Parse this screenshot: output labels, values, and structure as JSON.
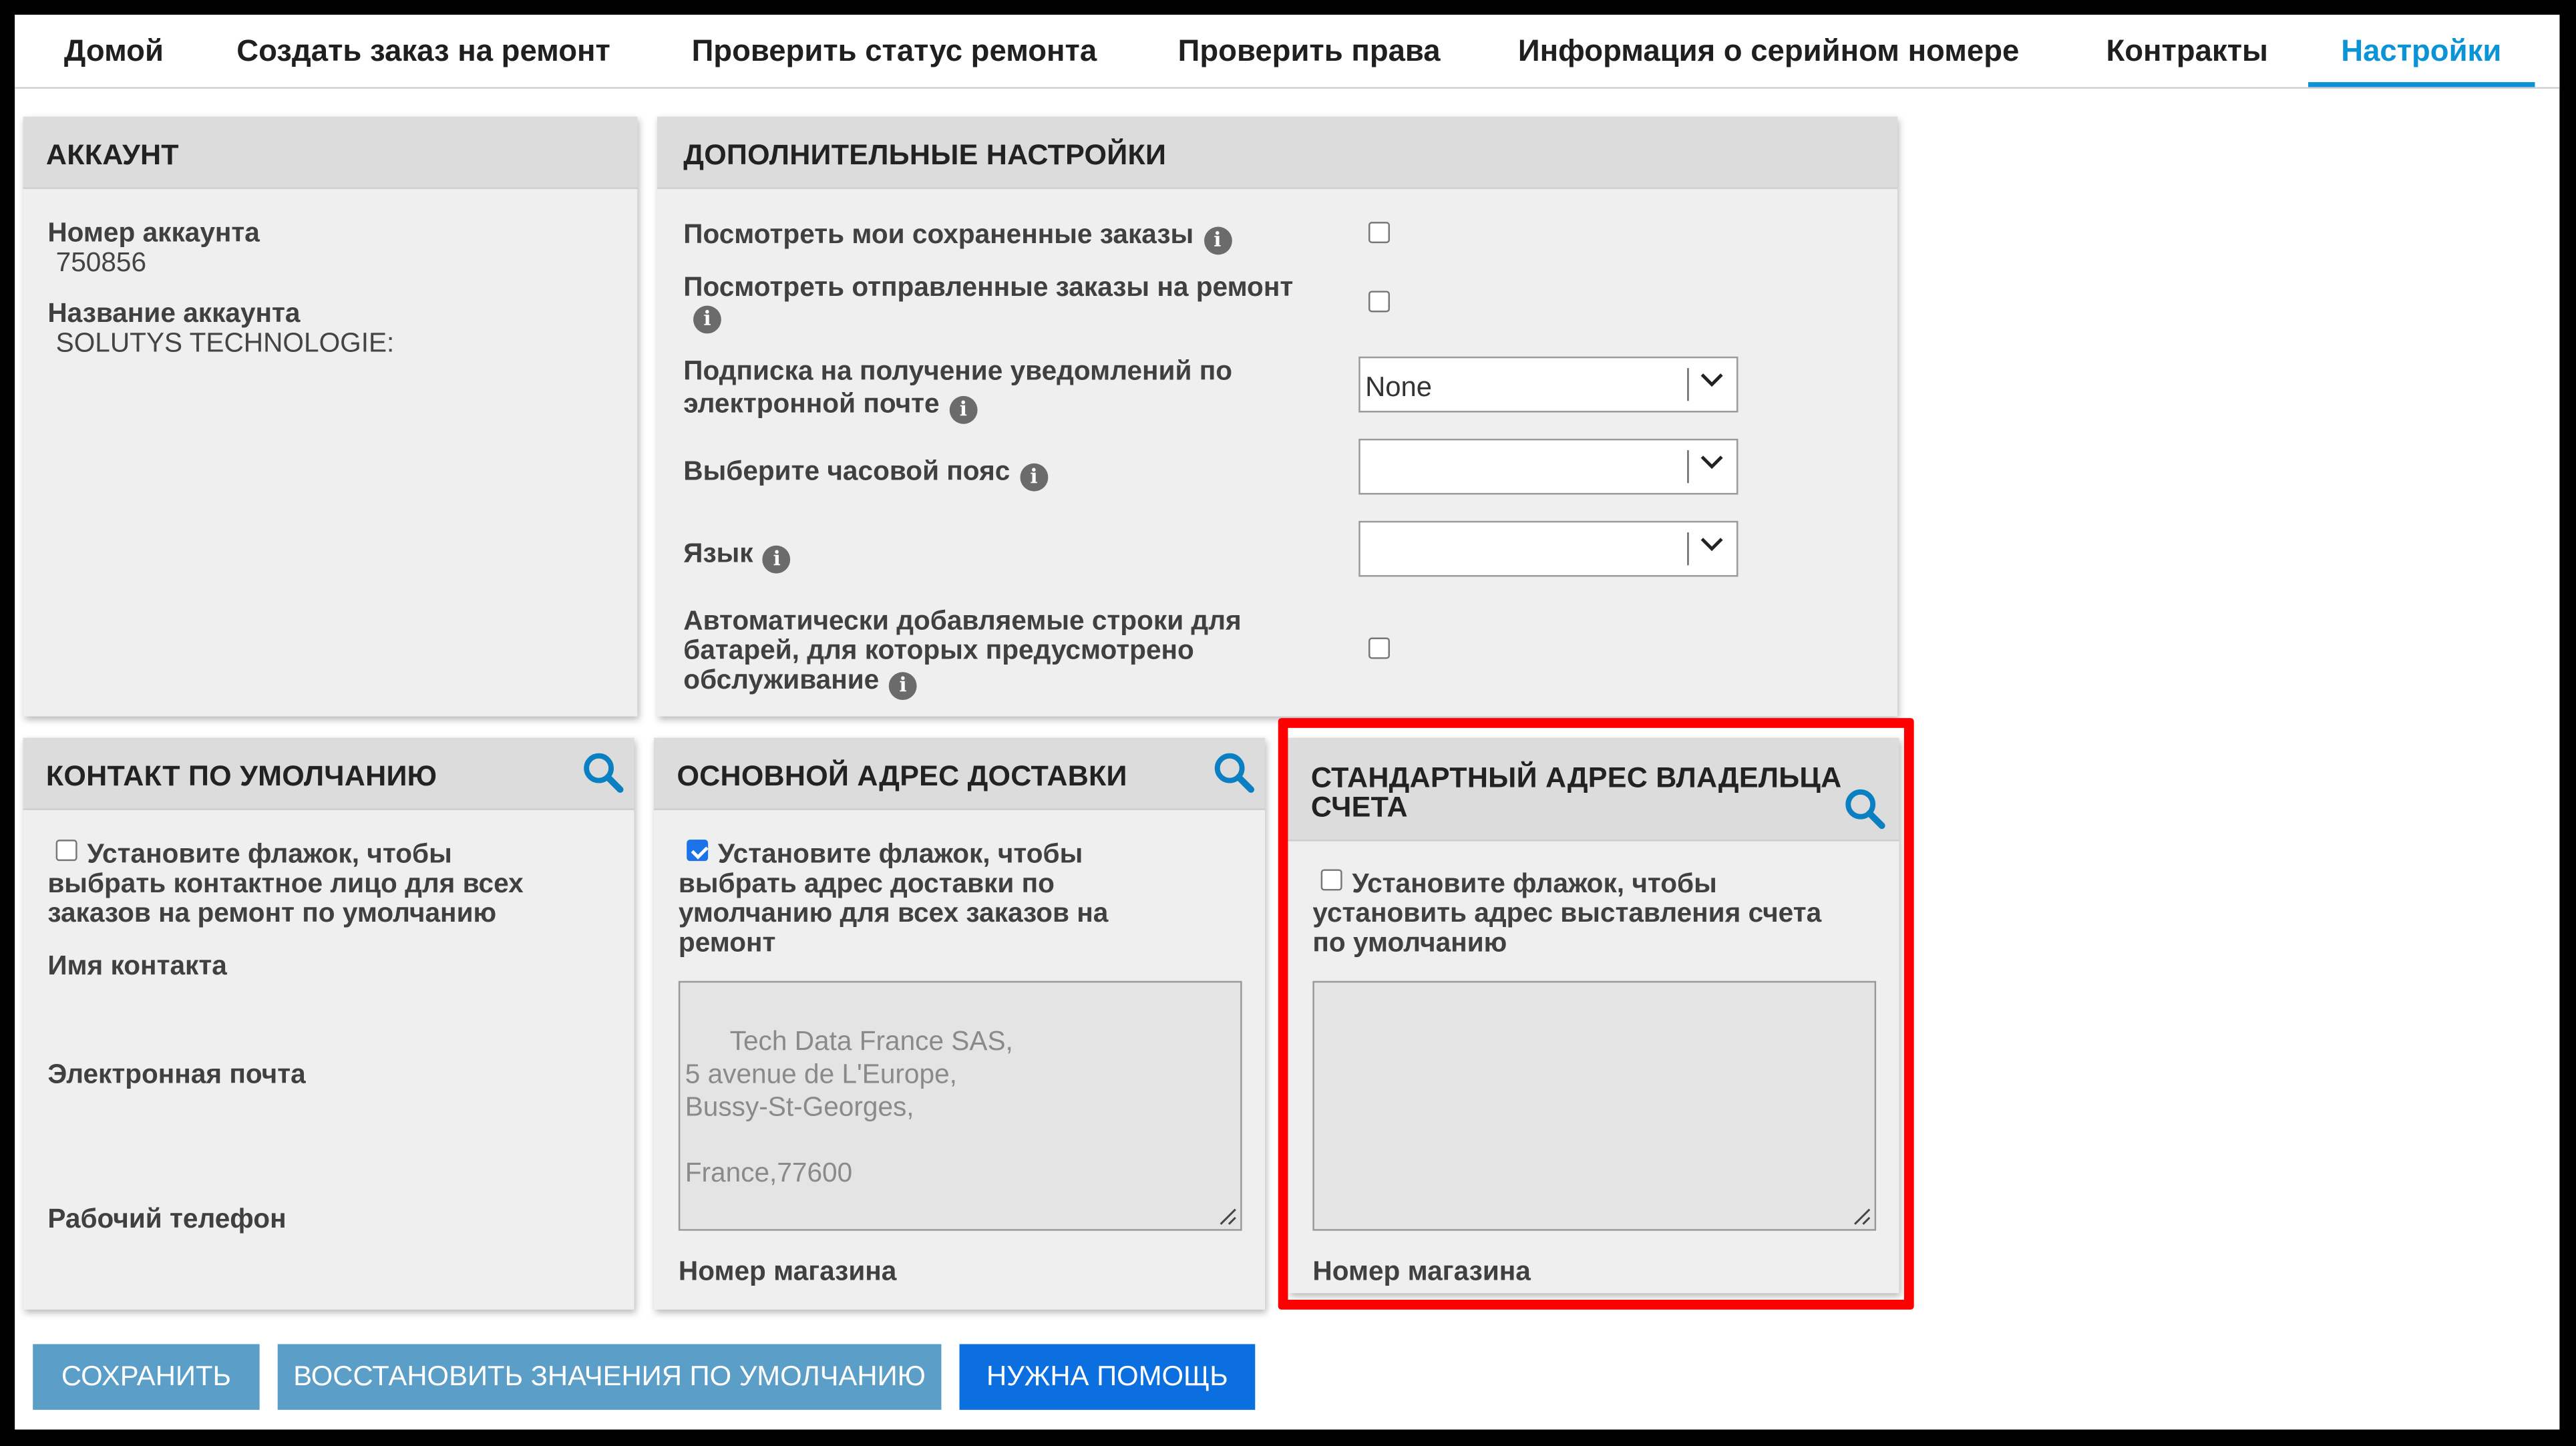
{
  "nav": {
    "items": [
      {
        "label": "Домой"
      },
      {
        "label": "Создать заказ на ремонт"
      },
      {
        "label": "Проверить статус ремонта"
      },
      {
        "label": "Проверить права"
      },
      {
        "label": "Информация о серийном номере"
      },
      {
        "label": "Контракты"
      },
      {
        "label": "Настройки"
      }
    ],
    "active": "Настройки",
    "accent_color": "#0a93d6"
  },
  "account": {
    "title": "АККАУНТ",
    "number_label": "Номер аккаунта",
    "number_value": "750856",
    "name_label": "Название аккаунта",
    "name_value": "SOLUTYS TECHNOLOGIE:"
  },
  "extra_settings": {
    "title": "ДОПОЛНИТЕЛЬНЫЕ НАСТРОЙКИ",
    "saved_orders_label": "Посмотреть мои сохраненные заказы",
    "sent_orders_label": "Посмотреть отправленные заказы на ремонт",
    "email_sub_label_1": "Подписка на получение уведомлений по",
    "email_sub_label_2": "электронной почте",
    "email_sub_value": "None",
    "timezone_label": "Выберите часовой пояс",
    "timezone_value": "",
    "language_label": "Язык",
    "language_value": "",
    "battery_label_1": "Автоматически добавляемые строки для",
    "battery_label_2": "батарей, для которых предусмотрено",
    "battery_label_3": "обслуживание"
  },
  "default_contact": {
    "title": "КОНТАКТ ПО УМОЛЧАНИЮ",
    "checkbox_line_1": "Установите флажок, чтобы",
    "checkbox_line_2": "выбрать контактное лицо для всех",
    "checkbox_line_3": "заказов на ремонт по умолчанию",
    "contact_name_label": "Имя контакта",
    "email_label": "Электронная почта",
    "phone_label": "Рабочий телефон"
  },
  "shipping": {
    "title": "ОСНОВНОЙ АДРЕС ДОСТАВКИ",
    "checkbox_line_1": "Установите флажок, чтобы",
    "checkbox_line_2": "выбрать адрес доставки по",
    "checkbox_line_3": "умолчанию для всех заказов на",
    "checkbox_line_4": "ремонт",
    "address": "Tech Data France SAS,\n5 avenue de L'Europe,\nBussy-St-Georges,\n\nFrance,77600",
    "store_label": "Номер магазина"
  },
  "billing": {
    "title_1": "СТАНДАРТНЫЙ АДРЕС ВЛАДЕЛЬЦА",
    "title_2": "СЧЕТА",
    "checkbox_line_1": "Установите флажок, чтобы",
    "checkbox_line_2": "установить адрес выставления счета",
    "checkbox_line_3": "по умолчанию",
    "address": "",
    "store_label": "Номер магазина"
  },
  "buttons": {
    "save": "СОХРАНИТЬ",
    "restore": "ВОССТАНОВИТЬ ЗНАЧЕНИЯ ПО УМОЛЧАНИЮ",
    "help": "НУЖНА ПОМОЩЬ"
  },
  "colors": {
    "highlight": "#ff0000",
    "button_muted": "#5b9fc9",
    "button_primary": "#0b6fe0",
    "search_icon": "#0a7fc2"
  },
  "icons": {
    "search": "search-icon",
    "info": "info-icon",
    "dropdown": "chevron-down-icon"
  }
}
